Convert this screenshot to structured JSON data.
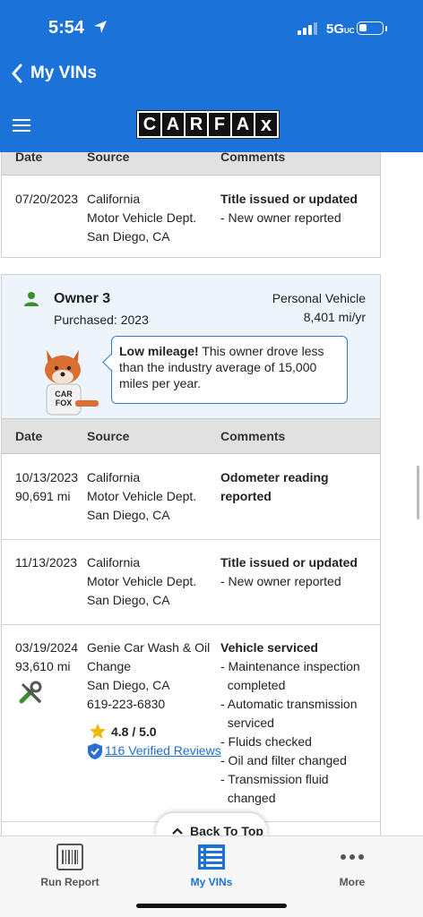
{
  "status_bar": {
    "time": "5:54",
    "network": "5G",
    "network_suffix": "UC"
  },
  "nav": {
    "back_label": "My VINs"
  },
  "header": {
    "logo_text": "CARFAX"
  },
  "colors": {
    "brand_blue": "#1b72d8",
    "link_blue": "#1f6fd0",
    "owner_icon_green": "#3a8f2e",
    "star_gold": "#f2b705",
    "shield_blue": "#2b6fd0"
  },
  "icons": {
    "menu": "hamburger-icon",
    "back": "chevron-left-icon",
    "location": "location-arrow-icon",
    "back_to_top": "chevron-up-icon",
    "owner": "person-icon",
    "service": "tools-icon",
    "rating": "star-icon",
    "verified": "shield-check-icon"
  },
  "table_headers": {
    "date": "Date",
    "source": "Source",
    "comments": "Comments"
  },
  "owner2_records": [
    {
      "date": "07/20/2023",
      "mileage": "",
      "source": [
        "California",
        "Motor Vehicle Dept.",
        "San Diego, CA"
      ],
      "comment_title": "Title issued or updated",
      "comment_items": [
        "- New owner reported"
      ]
    }
  ],
  "owner3": {
    "title": "Owner 3",
    "purchased": "Purchased: 2023",
    "vehicle_type": "Personal Vehicle",
    "mileage_rate": "8,401 mi/yr",
    "bubble_bold": "Low mileage!",
    "bubble_text": " This owner drove less than the industry average of 15,000 miles per year.",
    "mascot_shirt": [
      "CAR",
      "FOX"
    ]
  },
  "owner3_records": [
    {
      "date": "10/13/2023",
      "mileage": "90,691 mi",
      "source": [
        "California",
        "Motor Vehicle Dept.",
        "San Diego, CA"
      ],
      "comment_title": [
        "Odometer reading",
        "reported"
      ],
      "comment_items": []
    },
    {
      "date": "11/13/2023",
      "mileage": "",
      "source": [
        "California",
        "Motor Vehicle Dept.",
        "San Diego, CA"
      ],
      "comment_title": [
        "Title issued or updated"
      ],
      "comment_items": [
        "- New owner reported"
      ]
    },
    {
      "date": "03/19/2024",
      "mileage": "93,610 mi",
      "source": [
        "Genie Car Wash & Oil",
        "Change",
        "San Diego, CA",
        "619-223-6830"
      ],
      "rating": "4.8 / 5.0",
      "reviews": "116 Verified Reviews",
      "comment_title": [
        "Vehicle serviced"
      ],
      "comment_items": [
        "- Maintenance inspection",
        "  completed",
        "- Automatic transmission",
        "  serviced",
        "- Fluids checked",
        "- Oil and filter changed",
        "- Transmission fluid",
        "  changed"
      ]
    }
  ],
  "back_to_top": "Back To Top",
  "tabs": [
    {
      "label": "Run Report",
      "active": false
    },
    {
      "label": "My VINs",
      "active": true
    },
    {
      "label": "More",
      "active": false
    }
  ]
}
